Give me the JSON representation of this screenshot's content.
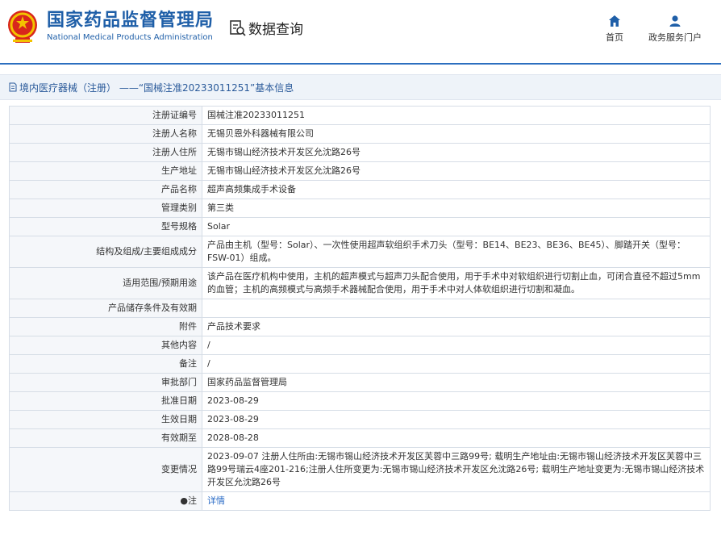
{
  "header": {
    "logo_cn": "国家药品监督管理局",
    "logo_en": "National Medical Products Administration",
    "query_label": "数据查询",
    "nav": [
      {
        "label": "首页",
        "icon": "home-icon"
      },
      {
        "label": "政务服务门户",
        "icon": "user-icon"
      }
    ]
  },
  "breadcrumb": {
    "text": "境内医疗器械（注册） ——“国械注准20233011251”基本信息"
  },
  "colors": {
    "brand": "#1f5fa8",
    "link": "#2a6bc6",
    "key_bg": "#f5f7fa",
    "border": "#d6dde6"
  },
  "table": {
    "rows": [
      {
        "key": "注册证编号",
        "value": "国械注准20233011251"
      },
      {
        "key": "注册人名称",
        "value": "无锡贝恩外科器械有限公司"
      },
      {
        "key": "注册人住所",
        "value": "无锡市锡山经济技术开发区允沈路26号"
      },
      {
        "key": "生产地址",
        "value": "无锡市锡山经济技术开发区允沈路26号"
      },
      {
        "key": "产品名称",
        "value": "超声高频集成手术设备"
      },
      {
        "key": "管理类别",
        "value": "第三类"
      },
      {
        "key": "型号规格",
        "value": "Solar"
      },
      {
        "key": "结构及组成/主要组成成分",
        "value": "产品由主机（型号：Solar）、一次性使用超声软组织手术刀头（型号：BE14、BE23、BE36、BE45）、脚踏开关（型号：FSW-01）组成。"
      },
      {
        "key": "适用范围/预期用途",
        "value": "该产品在医疗机构中使用，主机的超声模式与超声刀头配合使用，用于手术中对软组织进行切割止血，可闭合直径不超过5mm的血管；主机的高频模式与高频手术器械配合使用，用于手术中对人体软组织进行切割和凝血。"
      },
      {
        "key": "产品储存条件及有效期",
        "value": ""
      },
      {
        "key": "附件",
        "value": "产品技术要求"
      },
      {
        "key": "其他内容",
        "value": "/"
      },
      {
        "key": "备注",
        "value": "/"
      },
      {
        "key": "审批部门",
        "value": "国家药品监督管理局"
      },
      {
        "key": "批准日期",
        "value": "2023-08-29"
      },
      {
        "key": "生效日期",
        "value": "2023-08-29"
      },
      {
        "key": "有效期至",
        "value": "2028-08-28"
      },
      {
        "key": "变更情况",
        "value": "2023-09-07 注册人住所由:无锡市锡山经济技术开发区芙蓉中三路99号; 载明生产地址由:无锡市锡山经济技术开发区芙蓉中三路99号瑞云4座201-216;注册人住所变更为:无锡市锡山经济技术开发区允沈路26号; 载明生产地址变更为:无锡市锡山经济技术开发区允沈路26号"
      },
      {
        "key": "●注",
        "value": "详情",
        "is_link": true
      }
    ]
  }
}
